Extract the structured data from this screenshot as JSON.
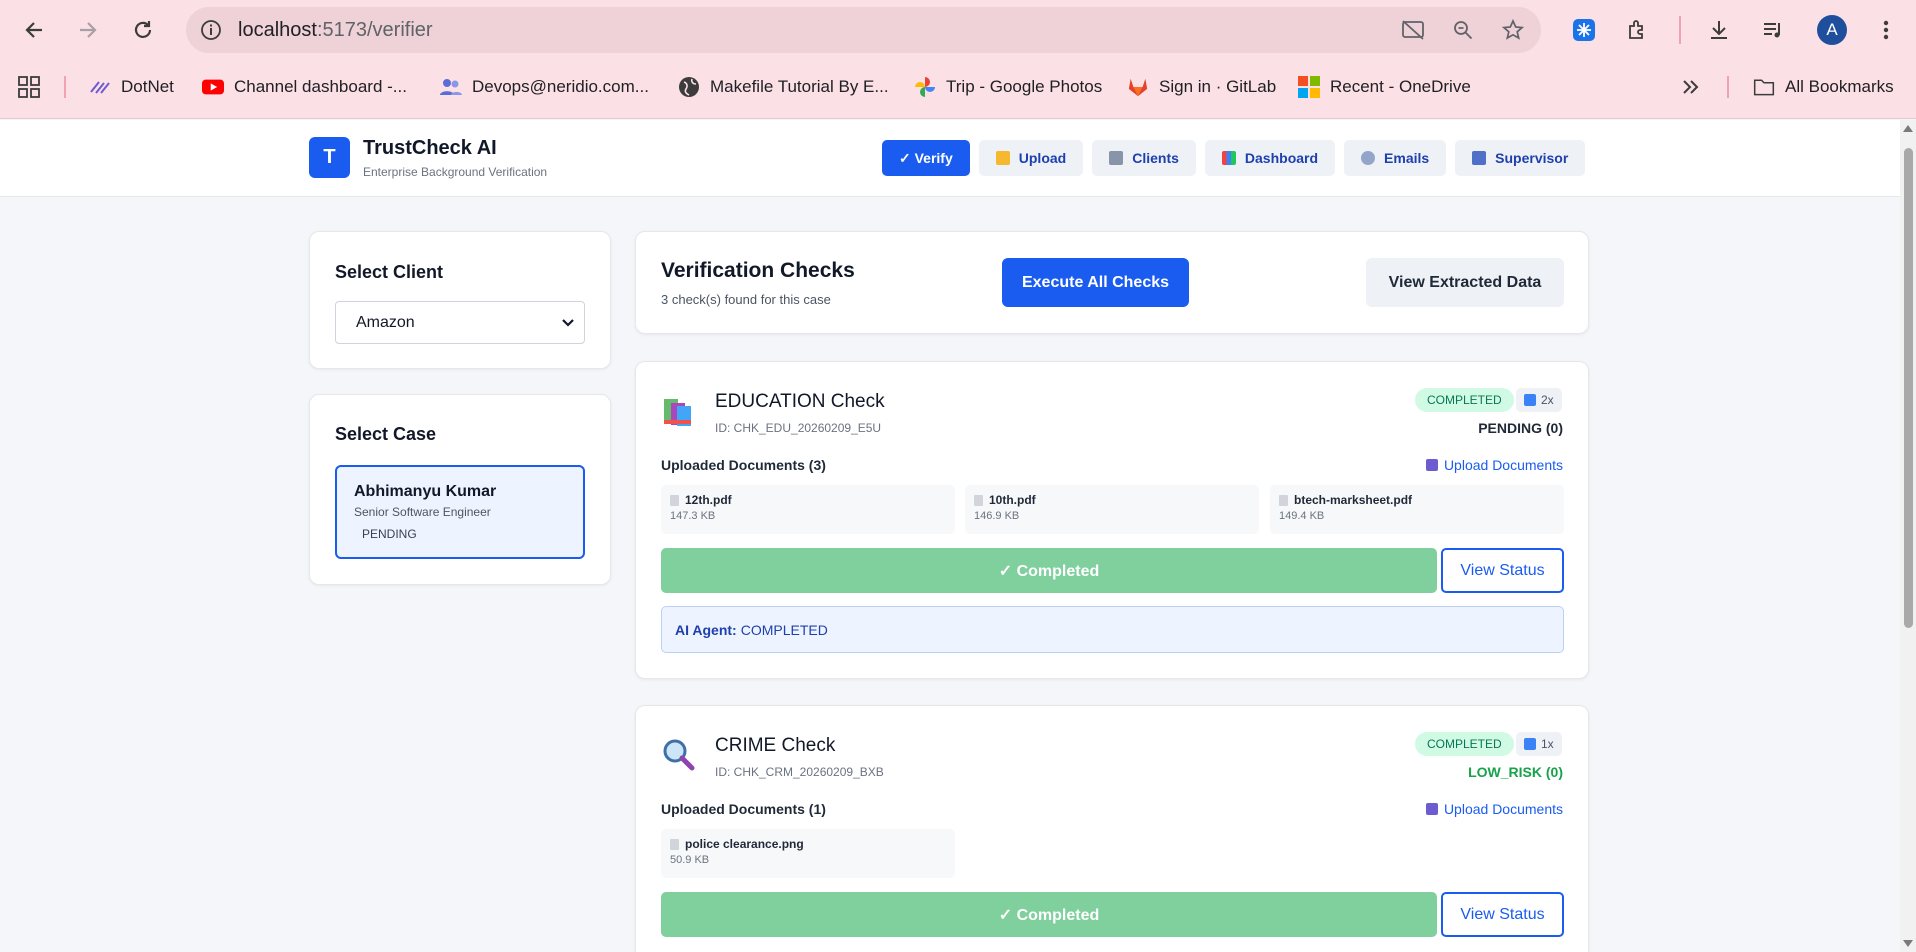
{
  "browser": {
    "url_host": "localhost",
    "url_path": ":5173/verifier",
    "bookmarks": [
      {
        "label": "DotNet",
        "icon": "dotnet-icon"
      },
      {
        "label": "Channel dashboard -...",
        "icon": "youtube-icon"
      },
      {
        "label": "Devops@neridio.com...",
        "icon": "people-icon"
      },
      {
        "label": "Makefile Tutorial By E...",
        "icon": "globe-icon"
      },
      {
        "label": "Trip - Google Photos",
        "icon": "google-photos-icon"
      },
      {
        "label": "Sign in · GitLab",
        "icon": "gitlab-icon"
      },
      {
        "label": "Recent - OneDrive",
        "icon": "onedrive-icon"
      }
    ],
    "all_bookmarks_label": "All Bookmarks",
    "profile_initial": "A"
  },
  "app": {
    "logo_letter": "T",
    "title": "TrustCheck AI",
    "subtitle": "Enterprise Background Verification",
    "nav": [
      {
        "label": "✓ Verify",
        "active": true
      },
      {
        "label": "Upload",
        "active": false
      },
      {
        "label": "Clients",
        "active": false
      },
      {
        "label": "Dashboard",
        "active": false
      },
      {
        "label": "Emails",
        "active": false
      },
      {
        "label": "Supervisor",
        "active": false
      }
    ]
  },
  "sidebar": {
    "client_heading": "Select Client",
    "client_value": "Amazon",
    "case_heading": "Select Case",
    "case": {
      "name": "Abhimanyu Kumar",
      "role": "Senior Software Engineer",
      "status": "PENDING"
    }
  },
  "main": {
    "title": "Verification Checks",
    "subtitle": "3 check(s) found for this case",
    "execute_label": "Execute All Checks",
    "view_data_label": "View Extracted Data",
    "checks": [
      {
        "title": "EDUCATION Check",
        "id": "ID: CHK_EDU_20260209_E5U",
        "status_badge": "COMPLETED",
        "attempts": "2x",
        "result": "PENDING (0)",
        "result_color": "#1f2937",
        "docs_label": "Uploaded Documents (3)",
        "upload_label": "Upload Documents",
        "documents": [
          {
            "name": "12th.pdf",
            "size": "147.3 KB"
          },
          {
            "name": "10th.pdf",
            "size": "146.9 KB"
          },
          {
            "name": "btech-marksheet.pdf",
            "size": "149.4 KB"
          }
        ],
        "completed_label": "✓ Completed",
        "view_status_label": "View Status",
        "ai_agent_label": "AI Agent:",
        "ai_agent_value": "COMPLETED"
      },
      {
        "title": "CRIME Check",
        "id": "ID: CHK_CRM_20260209_BXB",
        "status_badge": "COMPLETED",
        "attempts": "1x",
        "result": "LOW_RISK (0)",
        "result_color": "#16a34a",
        "docs_label": "Uploaded Documents (1)",
        "upload_label": "Upload Documents",
        "documents": [
          {
            "name": "police clearance.png",
            "size": "50.9 KB"
          }
        ],
        "completed_label": "✓ Completed",
        "view_status_label": "View Status"
      }
    ]
  },
  "colors": {
    "accent": "#1a5cf0",
    "completed_green": "#7fd09d",
    "chrome_pink": "#fbe0e6"
  }
}
